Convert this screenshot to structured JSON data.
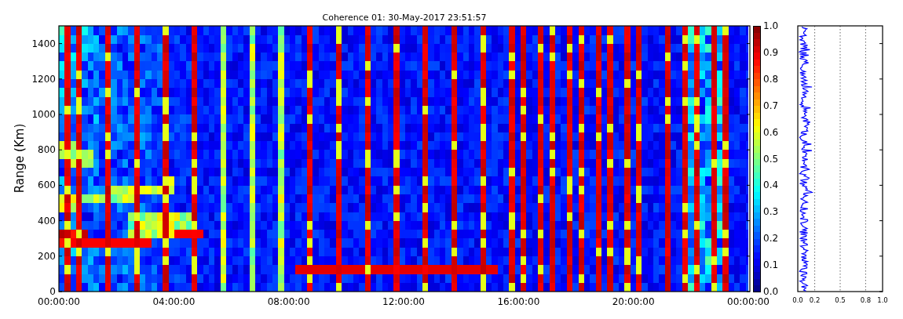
{
  "title": "Coherence 01: 30-May-2017 23:51:57",
  "range_plot": {
    "ylabel": "Range (Km)",
    "yticks": [
      "1400",
      "1200",
      "1000",
      "800",
      "600",
      "400",
      "200",
      "0"
    ],
    "xticks": [
      "00:00:00",
      "04:00:00",
      "08:00:00",
      "12:00:00",
      "16:00:00",
      "20:00:00",
      "00:00:00"
    ]
  },
  "colorbar": {
    "ticks": [
      "1.0",
      "0.9",
      "0.8",
      "0.7",
      "0.6",
      "0.5",
      "0.4",
      "0.3",
      "0.2",
      "0.1",
      "0.0"
    ]
  },
  "profile_plot": {
    "xticks": [
      "0.0",
      "0.2",
      "0.5",
      "0.8",
      "1.0"
    ]
  }
}
